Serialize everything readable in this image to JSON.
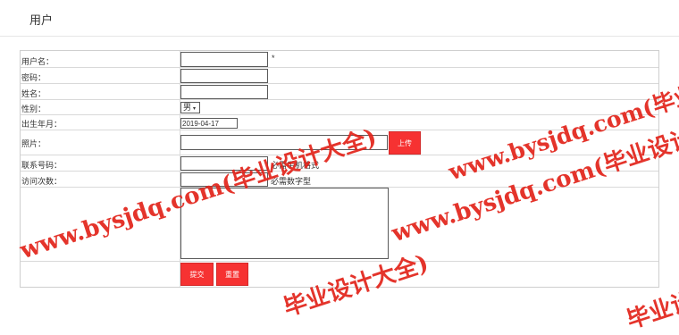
{
  "header": {
    "title": "用户"
  },
  "form": {
    "username": {
      "label": "用户名：",
      "value": "",
      "required_mark": "*"
    },
    "password": {
      "label": "密码：",
      "value": ""
    },
    "name": {
      "label": "姓名：",
      "value": ""
    },
    "gender": {
      "label": "性别：",
      "selected": "男",
      "caret": "▾"
    },
    "birth": {
      "label": "出生年月：",
      "value": "2019-04-17"
    },
    "photo": {
      "label": "照片：",
      "value": "",
      "upload_label": "上传"
    },
    "phone": {
      "label": "联系号码：",
      "value": "",
      "hint": "必需手机格式"
    },
    "visits": {
      "label": "访问次数：",
      "value": "",
      "hint": "必需数字型"
    },
    "remark": {
      "label": "",
      "value": ""
    },
    "buttons": {
      "submit_label": "提交",
      "reset_label": "重置"
    }
  },
  "watermarks": [
    "www.bysjdq.com(毕业设计大全)",
    "www.bysjdq.com(毕业设计大全)",
    "www.bysjdq.com(毕业设计大全)",
    "毕业设计大全)",
    "毕业设计大全)"
  ],
  "colors": {
    "accent": "#f63232",
    "watermark": "#e2231a",
    "border": "#d9d9d9"
  }
}
